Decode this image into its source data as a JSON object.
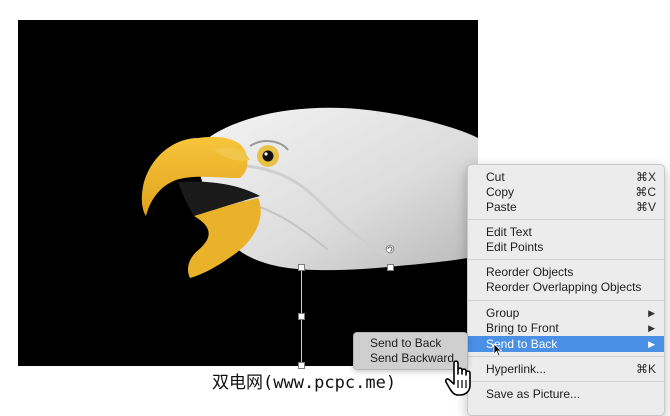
{
  "context_menu": {
    "items": [
      {
        "label": "Cut",
        "shortcut": "⌘X"
      },
      {
        "label": "Copy",
        "shortcut": "⌘C"
      },
      {
        "label": "Paste",
        "shortcut": "⌘V"
      },
      {
        "label": "Edit Text"
      },
      {
        "label": "Edit Points"
      },
      {
        "label": "Reorder Objects"
      },
      {
        "label": "Reorder Overlapping Objects"
      },
      {
        "label": "Group",
        "arrow": "▶"
      },
      {
        "label": "Bring to Front",
        "arrow": "▶"
      },
      {
        "label": "Send to Back",
        "arrow": "▶",
        "highlighted": true
      },
      {
        "label": "Hyperlink...",
        "shortcut": "⌘K"
      },
      {
        "label": "Save as Picture..."
      }
    ],
    "highlight_color": "#4a90e6"
  },
  "submenu": {
    "items": [
      {
        "label": "Send to Back"
      },
      {
        "label": "Send Backward"
      }
    ]
  },
  "watermark": "双电网(www.pcpc.me)"
}
